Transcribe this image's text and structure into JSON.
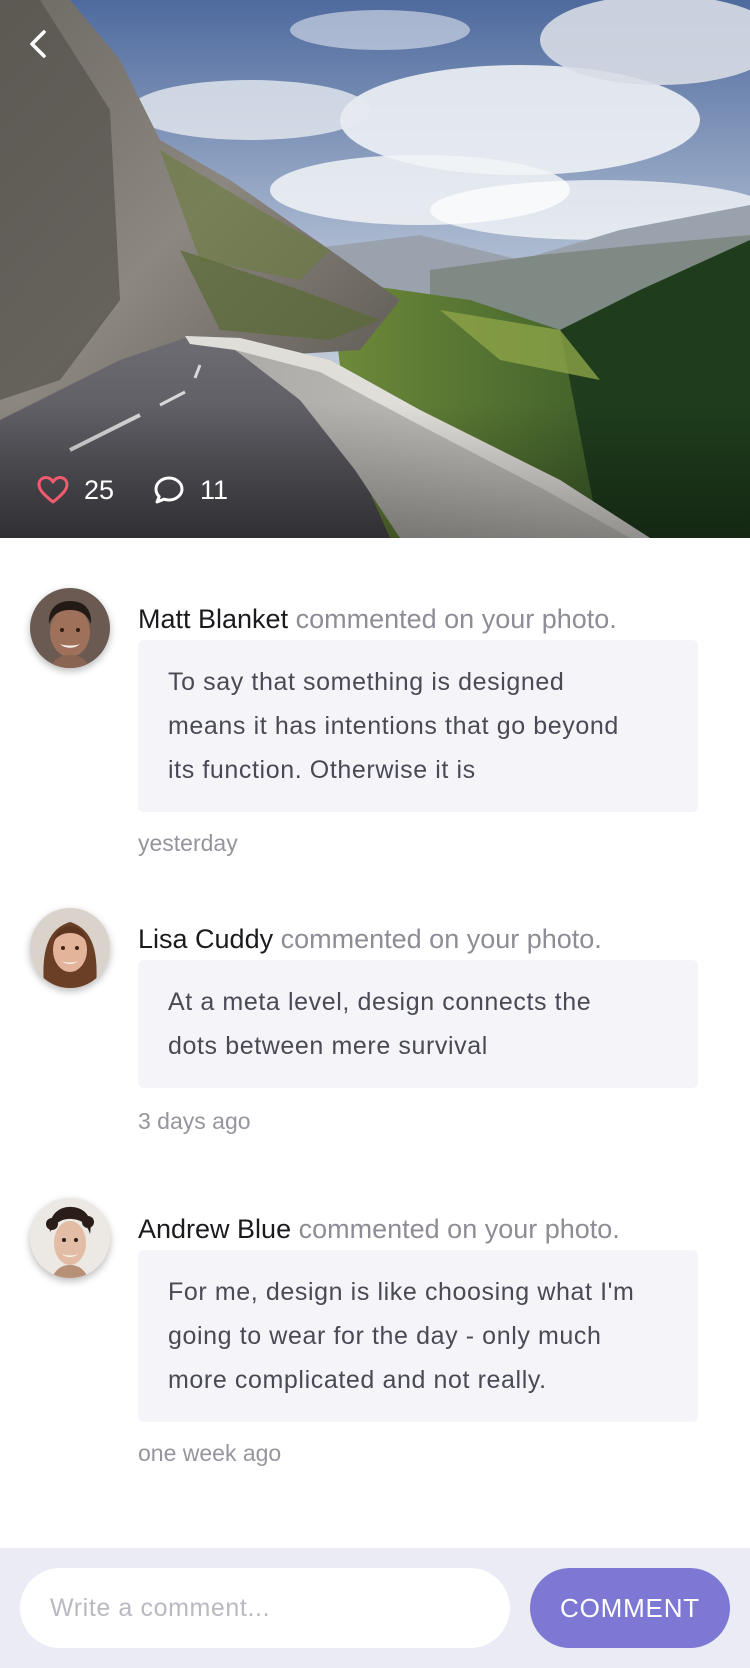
{
  "post": {
    "likes": "25",
    "comments": "11"
  },
  "comments": [
    {
      "author": "Matt Blanket",
      "action": "commented on your photo.",
      "lines": [
        "To say that something is designed",
        "means it has intentions that go beyond",
        "its function. Otherwise it is"
      ],
      "time": "yesterday"
    },
    {
      "author": "Lisa Cuddy",
      "action": "commented on your photo.",
      "lines": [
        "At a meta level, design connects the",
        "dots between mere survival"
      ],
      "time": "3 days ago"
    },
    {
      "author": "Andrew Blue",
      "action": "commented on your photo.",
      "lines": [
        "For me, design is like choosing what I'm",
        "going to wear for the day - only much",
        "more complicated and not really."
      ],
      "time": "one week ago"
    }
  ],
  "composer": {
    "placeholder": "Write a comment...",
    "button_label": "COMMENT"
  },
  "colors": {
    "accent": "#7c78d4",
    "heart": "#f25a6e",
    "bubble": "#f4f4f9",
    "composer_bg": "#ebebf5"
  },
  "icons": {
    "back": "chevron-left-icon",
    "like": "heart-icon",
    "comment": "speech-bubble-icon"
  }
}
